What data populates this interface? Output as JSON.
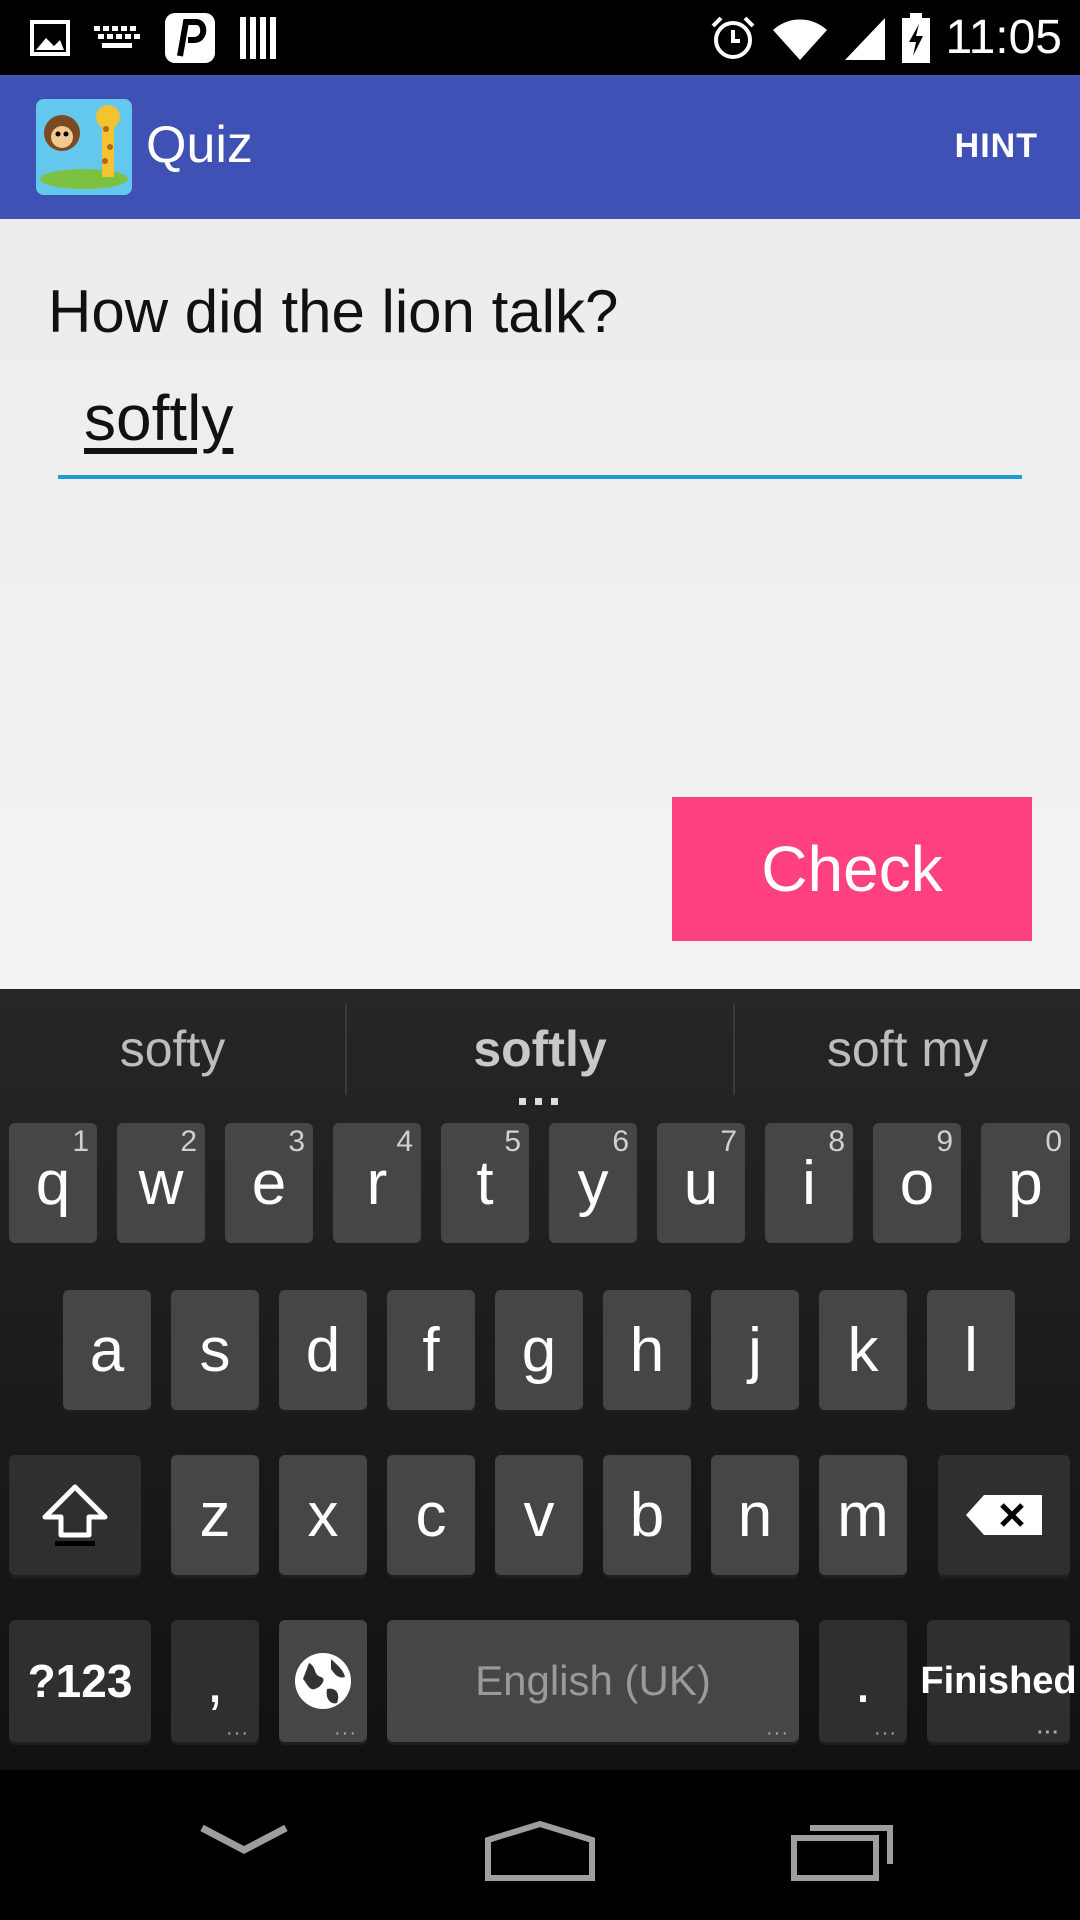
{
  "status_bar": {
    "time": "11:05",
    "icons": [
      "image-icon",
      "keyboard-icon",
      "pinterest-icon",
      "barcode-icon",
      "alarm-icon",
      "wifi-icon",
      "signal-icon",
      "battery-charging-icon"
    ]
  },
  "app_bar": {
    "title": "Quiz",
    "action": "HINT",
    "color": "#3f51b5"
  },
  "quiz": {
    "question": "How did the lion talk?",
    "answer": "softly",
    "check_label": "Check",
    "accent": "#ff4081"
  },
  "keyboard": {
    "suggestions": [
      "softy",
      "softly",
      "soft my"
    ],
    "row1": [
      {
        "k": "q",
        "n": "1"
      },
      {
        "k": "w",
        "n": "2"
      },
      {
        "k": "e",
        "n": "3"
      },
      {
        "k": "r",
        "n": "4"
      },
      {
        "k": "t",
        "n": "5"
      },
      {
        "k": "y",
        "n": "6"
      },
      {
        "k": "u",
        "n": "7"
      },
      {
        "k": "i",
        "n": "8"
      },
      {
        "k": "o",
        "n": "9"
      },
      {
        "k": "p",
        "n": "0"
      }
    ],
    "row2": [
      "a",
      "s",
      "d",
      "f",
      "g",
      "h",
      "j",
      "k",
      "l"
    ],
    "row3": [
      "z",
      "x",
      "c",
      "v",
      "b",
      "n",
      "m"
    ],
    "symbols_label": "?123",
    "comma_label": ",",
    "space_label": "English (UK)",
    "period_label": ".",
    "enter_label": "Finished"
  },
  "nav_bar": {
    "icons": [
      "back-icon",
      "home-icon",
      "recents-icon"
    ]
  }
}
